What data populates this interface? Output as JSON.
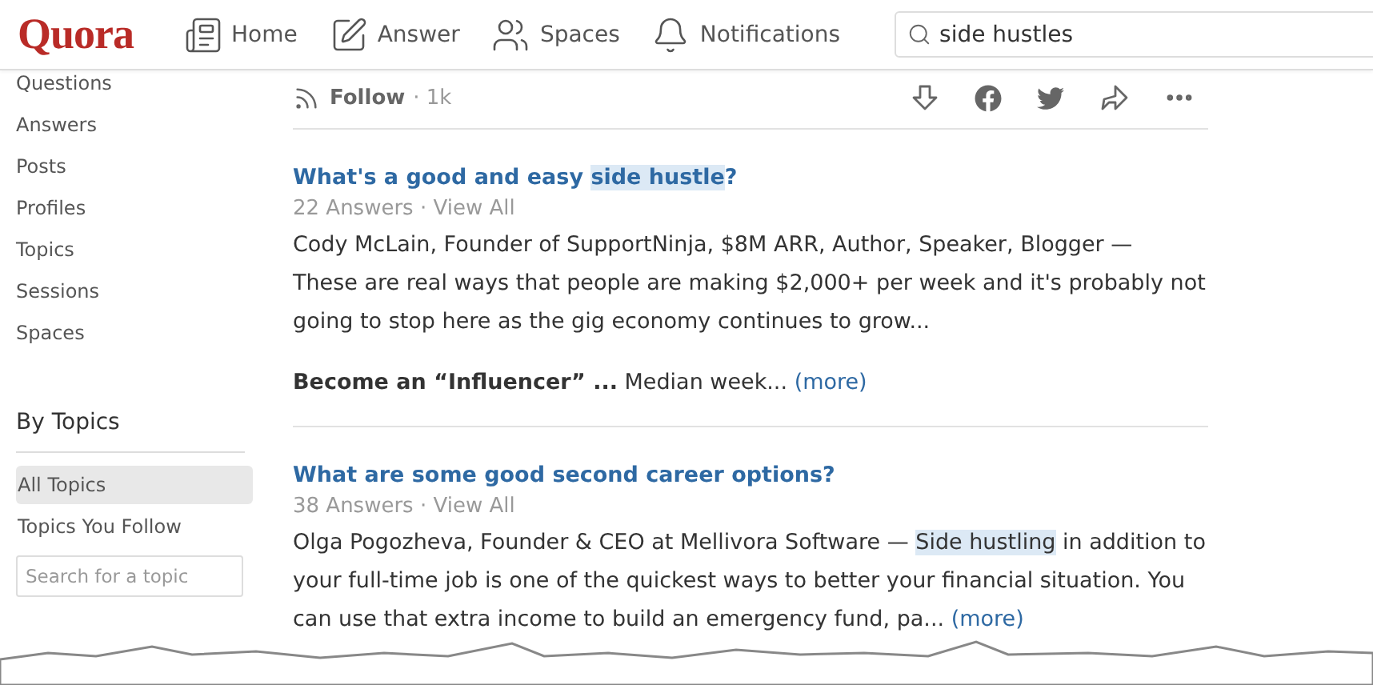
{
  "header": {
    "logo": "Quora",
    "nav": [
      {
        "kind": "home",
        "label": "Home"
      },
      {
        "kind": "answer",
        "label": "Answer"
      },
      {
        "kind": "spaces",
        "label": "Spaces"
      },
      {
        "kind": "notifications",
        "label": "Notifications"
      }
    ],
    "search": {
      "value": "side hustles"
    }
  },
  "sidebar": {
    "filters": [
      "Questions",
      "Answers",
      "Posts",
      "Profiles",
      "Topics",
      "Sessions",
      "Spaces"
    ],
    "topics_heading": "By Topics",
    "topics": [
      {
        "label": "All Topics",
        "selected": true
      },
      {
        "label": "Topics You Follow",
        "selected": false
      }
    ],
    "topic_search": {
      "placeholder": "Search for a topic"
    }
  },
  "follow_bar": {
    "label": "Follow",
    "count": "· 1k"
  },
  "results": [
    {
      "title": [
        {
          "text": "What's a good and easy ",
          "highlighted": false
        },
        {
          "text": "side hustle",
          "highlighted": true
        },
        {
          "text": "?",
          "highlighted": false
        }
      ],
      "answers": "22 Answers",
      "separator": "·",
      "view_all": "View All",
      "credential": "Cody McLain, Founder of SupportNinja, $8M ARR, Author, Speaker, Blogger —",
      "excerpt": [
        {
          "text": "These are real ways that people are making $2,000+ per week and it's probably not going to stop here as the gig economy continues to grow...",
          "highlighted": false
        }
      ],
      "teaser": "**Become an “Influencer” ...** Median week...",
      "more": "(more)"
    },
    {
      "title": [
        {
          "text": "What are some good second career options?",
          "highlighted": false
        }
      ],
      "answers": "38 Answers",
      "separator": "·",
      "view_all": "View All",
      "excerpt": [
        {
          "text": "Olga Pogozheva, Founder & CEO at Mellivora Software — ",
          "highlighted": false
        },
        {
          "text": "Side hustling",
          "highlighted": true
        },
        {
          "text": " in addition to your full-time job is one of the quickest ways to better your financial situation. You can use that extra income to build an emergency fund, pa...",
          "highlighted": false
        }
      ],
      "more": "(more)"
    }
  ]
}
